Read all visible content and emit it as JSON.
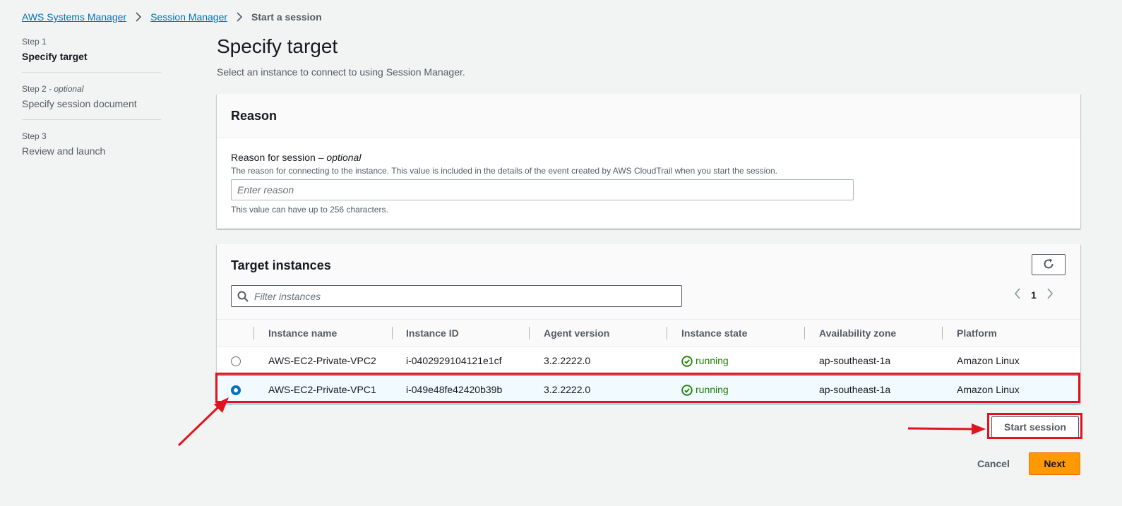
{
  "breadcrumb": {
    "items": [
      "AWS Systems Manager",
      "Session Manager"
    ],
    "current": "Start a session"
  },
  "steps": [
    {
      "num": "Step 1",
      "optional": "",
      "title": "Specify target"
    },
    {
      "num": "Step 2",
      "optional": "- optional",
      "title": "Specify session document"
    },
    {
      "num": "Step 3",
      "optional": "",
      "title": "Review and launch"
    }
  ],
  "page": {
    "title": "Specify target",
    "description": "Select an instance to connect to using Session Manager."
  },
  "reason": {
    "heading": "Reason",
    "label": "Reason for session",
    "label_optional": "– optional",
    "description": "The reason for connecting to the instance. This value is included in the details of the event created by AWS CloudTrail when you start the session.",
    "placeholder": "Enter reason",
    "hint": "This value can have up to 256 characters."
  },
  "targets": {
    "heading": "Target instances",
    "filter_placeholder": "Filter instances",
    "page": "1",
    "columns": [
      "Instance name",
      "Instance ID",
      "Agent version",
      "Instance state",
      "Availability zone",
      "Platform"
    ],
    "rows": [
      {
        "name": "AWS-EC2-Private-VPC2",
        "id": "i-0402929104121e1cf",
        "agent": "3.2.2222.0",
        "state": "running",
        "az": "ap-southeast-1a",
        "platform": "Amazon Linux",
        "selected": false
      },
      {
        "name": "AWS-EC2-Private-VPC1",
        "id": "i-049e48fe42420b39b",
        "agent": "3.2.2222.0",
        "state": "running",
        "az": "ap-southeast-1a",
        "platform": "Amazon Linux",
        "selected": true
      }
    ]
  },
  "actions": {
    "start_session": "Start session",
    "cancel": "Cancel",
    "next": "Next"
  },
  "colors": {
    "accent": "#ff9900",
    "link": "#0073bb",
    "success": "#1d8102",
    "annotation": "#e0141e"
  },
  "icons": [
    "chevron-right-icon",
    "refresh-icon",
    "search-icon",
    "chevron-left-icon",
    "check-circle-icon"
  ]
}
